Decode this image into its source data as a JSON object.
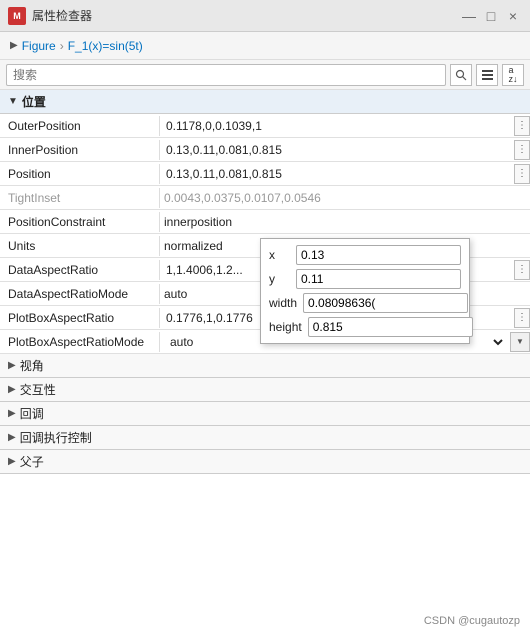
{
  "titlebar": {
    "icon_label": "M",
    "title": "属性检查器",
    "minimize_label": "—",
    "maximize_label": "□",
    "close_label": "×"
  },
  "breadcrumb": {
    "arrow": "▶",
    "item1": "Figure",
    "separator": "›",
    "item2": "F_1(x)=sin(5t)"
  },
  "search": {
    "placeholder": "搜索",
    "search_icon": "🔍",
    "list_icon": "≡",
    "sort_icon": "a↓z"
  },
  "section_position": {
    "label": "位置",
    "arrow": "▼"
  },
  "properties": [
    {
      "name": "OuterPosition",
      "value": "0.1178,0,0.1039,1",
      "type": "input_menu"
    },
    {
      "name": "InnerPosition",
      "value": "0.13,0.11,0.081,0.815",
      "type": "input_menu"
    },
    {
      "name": "Position",
      "value": "0.13,0.11,0.081,0.815",
      "type": "input_menu"
    },
    {
      "name": "TightInset",
      "value": "0.0043,0.0375,0.0107,0.0546",
      "type": "grayed"
    },
    {
      "name": "PositionConstraint",
      "value": "innerposition",
      "type": "dropdown"
    },
    {
      "name": "Units",
      "value": "normalized",
      "type": "dropdown"
    },
    {
      "name": "DataAspectRatio",
      "value": "1,1.4006,1.2...",
      "type": "input_menu"
    },
    {
      "name": "DataAspectRatioMode",
      "value": "auto",
      "type": "plain"
    },
    {
      "name": "PlotBoxAspectRatio",
      "value": "0.1776,1,0.1776",
      "type": "input_menu"
    },
    {
      "name": "PlotBoxAspectRatioMode",
      "value": "auto",
      "type": "dropdown_full"
    }
  ],
  "popup": {
    "x_label": "x",
    "x_value": "0.13",
    "y_label": "y",
    "y_value": "0.11",
    "width_label": "width",
    "width_value": "0.08098636(",
    "height_label": "height",
    "height_value": "0.815"
  },
  "collapsed_sections": [
    {
      "label": "视角"
    },
    {
      "label": "交互性"
    },
    {
      "label": "回调"
    },
    {
      "label": "回调执行控制"
    },
    {
      "label": "父子"
    }
  ],
  "watermark": "CSDN @cugautozp"
}
